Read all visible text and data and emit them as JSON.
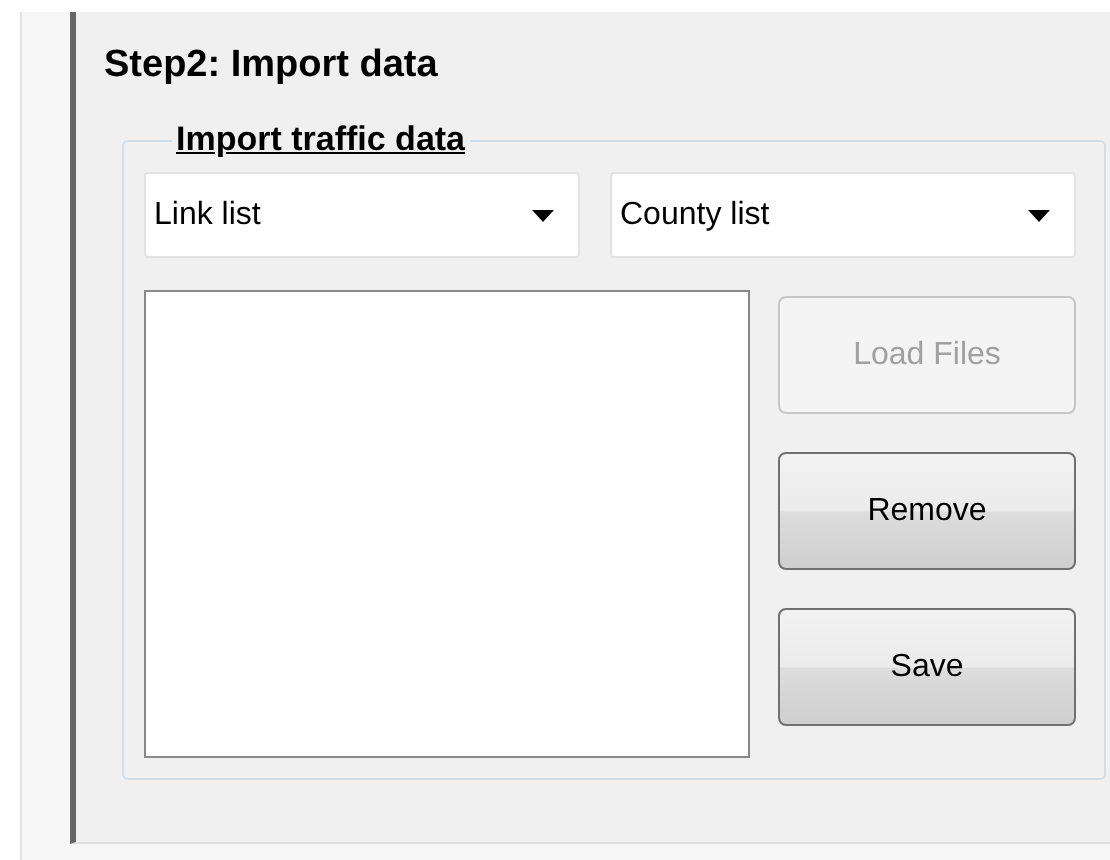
{
  "step_title": "Step2: Import data",
  "group": {
    "legend": "Import traffic data",
    "dropdowns": [
      {
        "value": "Link list"
      },
      {
        "value": "County list"
      }
    ],
    "buttons": [
      {
        "label": "Load Files",
        "disabled": true
      },
      {
        "label": "Remove",
        "disabled": false
      },
      {
        "label": "Save",
        "disabled": false
      }
    ]
  }
}
